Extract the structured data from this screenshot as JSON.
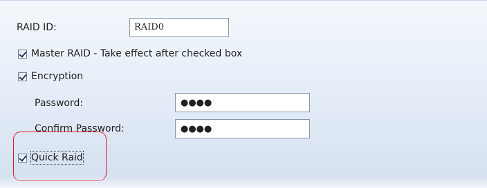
{
  "raid_id": {
    "label": "RAID ID:",
    "value": "RAID0"
  },
  "master_raid": {
    "label": "Master RAID - Take effect after checked box",
    "checked": true
  },
  "encryption": {
    "label": "Encryption",
    "checked": true,
    "password": {
      "label": "Password:",
      "masked_value": "●●●●"
    },
    "confirm_password": {
      "label": "Confirm Password:",
      "masked_value": "●●●●"
    }
  },
  "quick_raid": {
    "label": "Quick Raid",
    "checked": true
  },
  "colors": {
    "highlight": "#e41b1b",
    "panel_top": "#f4f8fc",
    "panel_bottom": "#d3dff0"
  }
}
